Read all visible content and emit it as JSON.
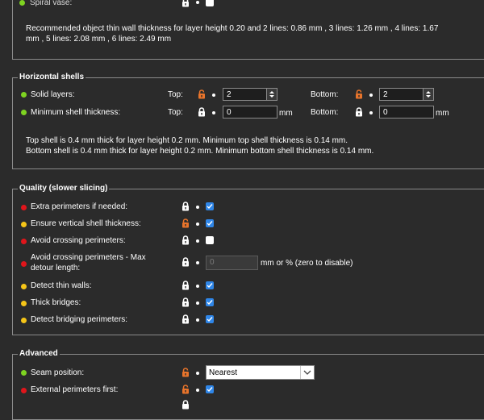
{
  "layers_group": {
    "spiral_vase_label": "Spiral vase:",
    "wall_thickness_note": "Recommended object thin wall thickness for layer height 0.20 and 2 lines: 0.86 mm , 3 lines: 1.26 mm , 4 lines: 1.67 mm , 5 lines: 2.08 mm , 6 lines: 2.49 mm",
    "spiral_vase_checked": false
  },
  "horizontal_shells": {
    "title": "Horizontal shells",
    "solid_layers_label": "Solid layers:",
    "min_shell_label": "Minimum shell thickness:",
    "top_label": "Top:",
    "bottom_label": "Bottom:",
    "top_layers": "2",
    "bottom_layers": "2",
    "top_min": "0",
    "bottom_min": "0",
    "unit": "mm",
    "note_line1": "Top shell is 0.4 mm thick for layer height 0.2 mm. Minimum top shell thickness is 0.14 mm.",
    "note_line2": "Bottom shell is 0.4 mm thick for layer height 0.2 mm. Minimum bottom shell thickness is 0.14 mm."
  },
  "quality": {
    "title": "Quality (slower slicing)",
    "items": [
      {
        "label": "Extra perimeters if needed:",
        "checked": true
      },
      {
        "label": "Ensure vertical shell thickness:",
        "checked": true
      },
      {
        "label": "Avoid crossing perimeters:",
        "checked": false
      },
      {
        "label": "Avoid crossing perimeters - Max",
        "label2": "detour length:"
      },
      {
        "label": "Detect thin walls:",
        "checked": true
      },
      {
        "label": "Thick bridges:",
        "checked": true
      },
      {
        "label": "Detect bridging perimeters:",
        "checked": true
      }
    ],
    "detour_value": "0",
    "detour_unit": "mm or % (zero to disable)"
  },
  "advanced": {
    "title": "Advanced",
    "seam_label": "Seam position:",
    "seam_value": "Nearest",
    "external_first_label": "External perimeters first:",
    "external_first_checked": true
  },
  "colors": {
    "background": "#2b2b2b",
    "accent_checkbox": "#2f86e8",
    "lock_modified": "#e8742b",
    "mode_simple": "#7ed321",
    "mode_advanced": "#f5c518",
    "mode_expert": "#e0151b"
  }
}
